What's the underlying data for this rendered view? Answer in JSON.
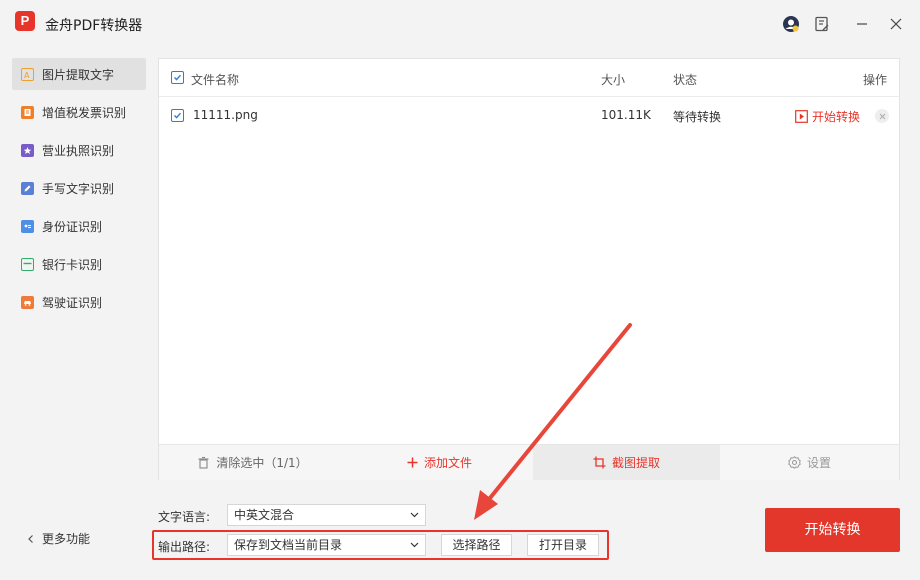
{
  "app": {
    "title": "金舟PDF转换器",
    "logo_text": "P"
  },
  "sidebar": {
    "items": [
      {
        "label": "图片提取文字",
        "icon": "image-text-icon",
        "color": "#f0a02c",
        "active": true
      },
      {
        "label": "增值税发票识别",
        "icon": "invoice-icon",
        "color": "#f07f2c"
      },
      {
        "label": "营业执照识别",
        "icon": "license-icon",
        "color": "#7a5cc8"
      },
      {
        "label": "手写文字识别",
        "icon": "pen-icon",
        "color": "#5a7fd6"
      },
      {
        "label": "身份证识别",
        "icon": "id-card-icon",
        "color": "#4f8fe6"
      },
      {
        "label": "银行卡识别",
        "icon": "bank-card-icon",
        "color": "#2fae6b"
      },
      {
        "label": "驾驶证识别",
        "icon": "car-icon",
        "color": "#ef7a3a"
      }
    ],
    "more_label": "更多功能"
  },
  "table": {
    "headers": {
      "name": "文件名称",
      "size": "大小",
      "status": "状态",
      "action": "操作"
    },
    "rows": [
      {
        "name": "11111.png",
        "size": "101.11K",
        "status": "等待转换",
        "action": "开始转换"
      }
    ]
  },
  "toolbar": {
    "clear": "清除选中（1/1）",
    "add": "添加文件",
    "crop": "截图提取",
    "settings": "设置"
  },
  "options": {
    "language_label": "文字语言:",
    "language_value": "中英文混合",
    "output_label": "输出路径:",
    "output_value": "保存到文档当前目录",
    "choose_path": "选择路径",
    "open_dir": "打开目录"
  },
  "primary_button": "开始转换",
  "colors": {
    "accent": "#e3372b",
    "checkbox": "#2c7be5"
  }
}
